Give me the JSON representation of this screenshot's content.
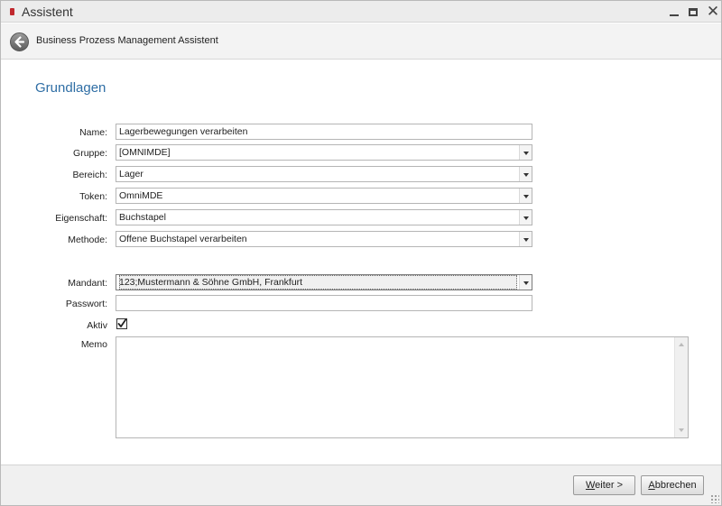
{
  "window": {
    "title": "Assistent"
  },
  "header": {
    "title": "Business Prozess Management Assistent"
  },
  "section": {
    "title": "Grundlagen"
  },
  "form": {
    "name_label": "Name:",
    "name_value": "Lagerbewegungen verarbeiten",
    "gruppe_label": "Gruppe:",
    "gruppe_value": "[OMNIMDE]",
    "bereich_label": "Bereich:",
    "bereich_value": "Lager",
    "token_label": "Token:",
    "token_value": "OmniMDE",
    "eigenschaft_label": "Eigenschaft:",
    "eigenschaft_value": "Buchstapel",
    "methode_label": "Methode:",
    "methode_value": "Offene Buchstapel verarbeiten",
    "mandant_label": "Mandant:",
    "mandant_value": "123;Mustermann & Söhne GmbH, Frankfurt",
    "passwort_label": "Passwort:",
    "passwort_value": "",
    "aktiv_label": "Aktiv",
    "aktiv_checked": true,
    "memo_label": "Memo",
    "memo_value": ""
  },
  "footer": {
    "weiter_label_key": "W",
    "weiter_label_rest": "eiter >",
    "abbrechen_label_key": "A",
    "abbrechen_label_rest": "bbrechen"
  },
  "icons": {
    "app": "app-icon",
    "back": "arrow-left-circle-icon",
    "minimize": "minimize-icon",
    "maximize": "maximize-icon",
    "close": "close-icon",
    "checkmark": "checkmark-icon"
  },
  "colors": {
    "accent": "#2f6ea5",
    "app_icon": "#c0282d"
  }
}
